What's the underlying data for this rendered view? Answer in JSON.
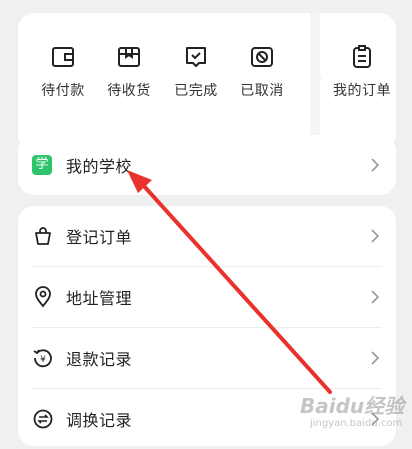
{
  "orders": {
    "items": [
      {
        "label": "待付款",
        "icon": "wallet-icon"
      },
      {
        "label": "待收货",
        "icon": "package-icon"
      },
      {
        "label": "已完成",
        "icon": "completed-icon"
      },
      {
        "label": "已取消",
        "icon": "cancelled-icon"
      }
    ],
    "all": {
      "label": "我的订单",
      "icon": "order-list-icon"
    }
  },
  "school": {
    "badge": "学",
    "label": "我的学校",
    "badge_color": "#2ec46a"
  },
  "menu": {
    "items": [
      {
        "label": "登记订单",
        "icon": "bag-icon"
      },
      {
        "label": "地址管理",
        "icon": "location-pin-icon"
      },
      {
        "label": "退款记录",
        "icon": "refund-icon"
      },
      {
        "label": "调换记录",
        "icon": "exchange-icon"
      }
    ]
  },
  "annotation": {
    "color": "#e8322b"
  },
  "watermark": {
    "main": "Baidu经验",
    "sub": "jingyan.baidu.com"
  }
}
